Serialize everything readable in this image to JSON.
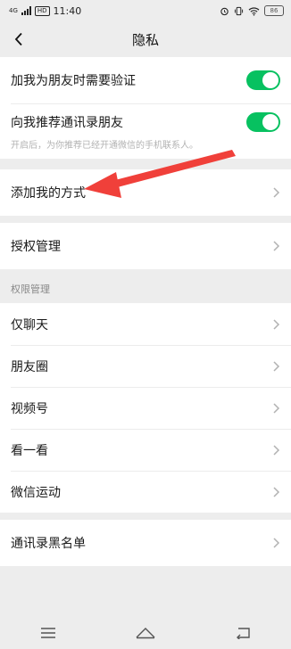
{
  "status_bar": {
    "network": "4G",
    "hd": "HD",
    "time": "11:40",
    "battery": "86"
  },
  "header": {
    "title": "隐私"
  },
  "verification": {
    "friend_verify_label": "加我为朋友时需要验证",
    "friend_verify_on": true,
    "recommend_contacts_label": "向我推荐通讯录朋友",
    "recommend_contacts_on": true,
    "recommend_hint": "开启后，为你推荐已经开通微信的手机联系人。"
  },
  "add_me": {
    "label": "添加我的方式"
  },
  "authorization": {
    "label": "授权管理"
  },
  "permissions": {
    "section_title": "权限管理",
    "items": [
      "仅聊天",
      "朋友圈",
      "视频号",
      "看一看",
      "微信运动"
    ]
  },
  "blacklist": {
    "label": "通讯录黑名单"
  },
  "colors": {
    "accent": "#07c160",
    "annotation_arrow": "#f0403a"
  }
}
